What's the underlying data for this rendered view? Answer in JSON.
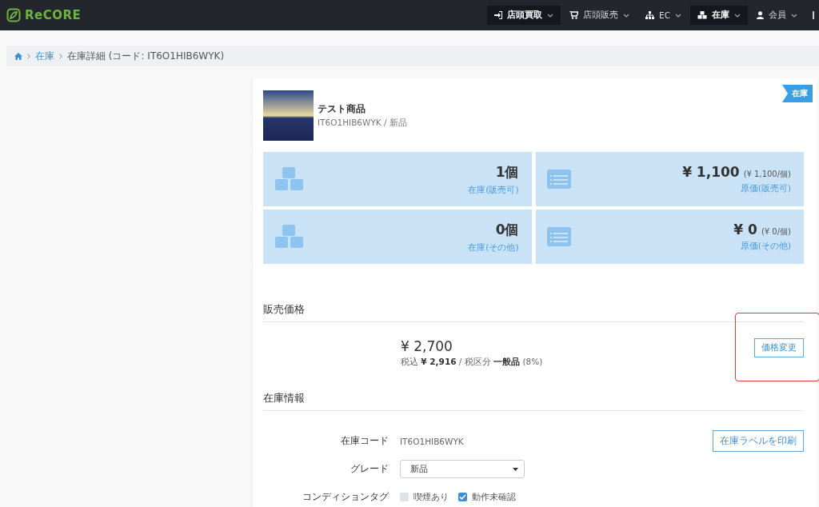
{
  "header": {
    "logo": "ReCORE",
    "nav": [
      {
        "label": "店頭買取",
        "selected": true
      },
      {
        "label": "店頭販売",
        "selected": false
      },
      {
        "label": "EC",
        "selected": false
      },
      {
        "label": "在庫",
        "selected": true
      },
      {
        "label": "会員",
        "selected": false
      }
    ]
  },
  "breadcrumb": {
    "link": "在庫",
    "current": "在庫詳細 (コード: IT6O1HIB6WYK)"
  },
  "product": {
    "badge": "在庫",
    "name": "テスト商品",
    "subtitle": "IT6O1HIB6WYK / 新品"
  },
  "tiles": [
    {
      "kind": "cubes",
      "value": "1個",
      "label": "在庫(販売可)"
    },
    {
      "kind": "list",
      "value": "¥ 1,100",
      "unit": "(¥ 1,100/個)",
      "label": "原価(販売可)"
    },
    {
      "kind": "cubes",
      "value": "0個",
      "label": "在庫(その他)"
    },
    {
      "kind": "list",
      "value": "¥ 0",
      "unit": "(¥ 0/個)",
      "label": "原価(その他)"
    }
  ],
  "sales_price": {
    "heading": "販売価格",
    "price": "¥ 2,700",
    "tax_note": "税込 **¥ 2,916** / 税区分 **一般品** (8%)",
    "button": "価格変更",
    "highlighted": true
  },
  "stock_info": {
    "heading": "在庫情報",
    "code_label": "在庫コード",
    "code": "IT6O1HIB6WYK",
    "print_button": "在庫ラベルを印刷",
    "grade_label": "グレード",
    "grade": "新品",
    "tags_label": "コンディションタグ",
    "tags": [
      {
        "label": "喫煙あり",
        "checked": false
      },
      {
        "label": "動作未確認",
        "checked": true
      }
    ]
  }
}
